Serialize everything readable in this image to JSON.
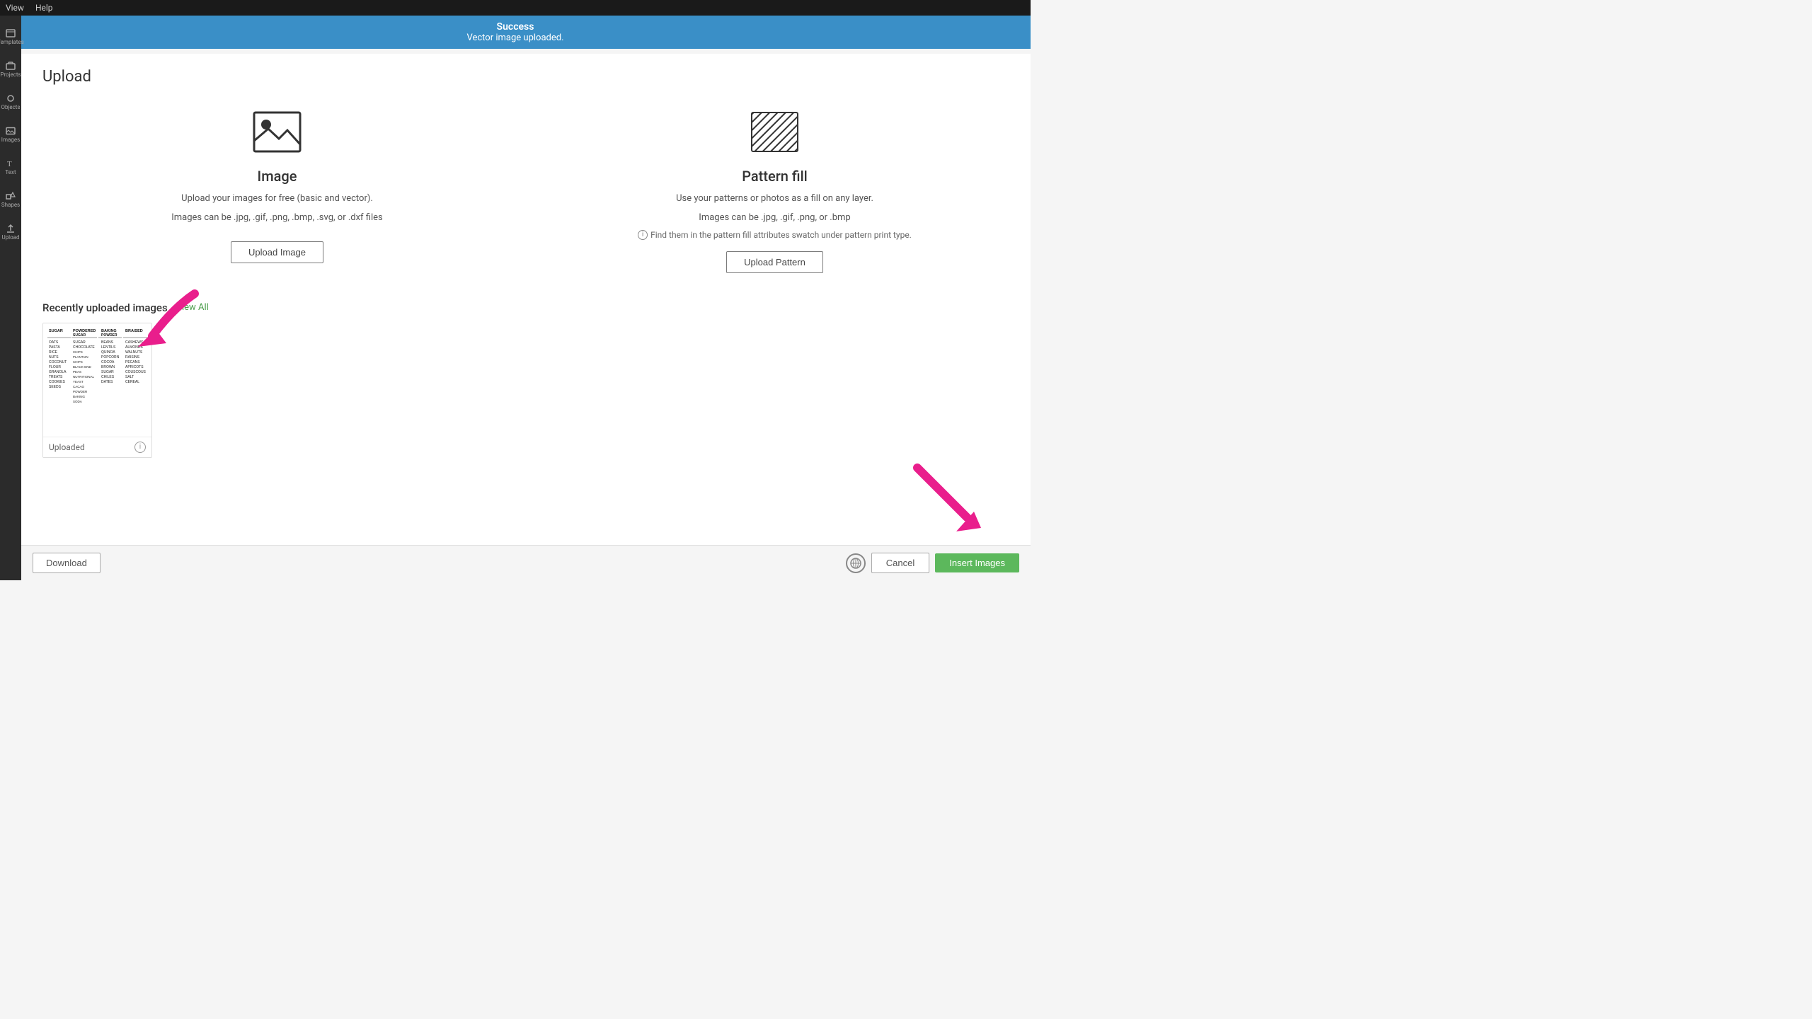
{
  "menuBar": {
    "items": [
      "View",
      "Help"
    ]
  },
  "successBanner": {
    "title": "Success",
    "subtitle": "Vector image uploaded."
  },
  "pageTitle": "Upload",
  "imageCard": {
    "title": "Image",
    "desc1": "Upload your images for free (basic and vector).",
    "desc2": "Images can be .jpg, .gif, .png, .bmp, .svg, or .dxf files",
    "buttonLabel": "Upload Image"
  },
  "patternCard": {
    "title": "Pattern fill",
    "desc1": "Use your patterns or photos as a fill on any layer.",
    "desc2": "Images can be .jpg, .gif, .png, or .bmp",
    "infoText": "Find them in the pattern fill attributes swatch under pattern print type.",
    "buttonLabel": "Upload Pattern"
  },
  "recentlyUploaded": {
    "title": "Recently uploaded images",
    "viewAllLabel": "View All",
    "thumbnails": [
      {
        "label": "Uploaded",
        "status": "uploaded"
      }
    ]
  },
  "bottomBar": {
    "downloadLabel": "Download",
    "cancelLabel": "Cancel",
    "insertLabel": "Insert Images"
  },
  "groceryColumns": [
    {
      "header": "SUGAR",
      "items": [
        "OATS",
        "PASTA",
        "RICE",
        "NUTS",
        "COCONUT",
        "FLOUR",
        "GRANOLA",
        "TREATS",
        "COOKIES",
        "SEEDS"
      ]
    },
    {
      "header": "POWDERED SUGAR",
      "items": [
        "SUGAR",
        "CHOCOLATE CHIPS",
        "PLANTAIN CHIPS",
        "BLACK-EYE PEAS",
        "NUTRITIONAL YEAST",
        "CACAO POWDER",
        "BAKING SODA"
      ]
    },
    {
      "header": "BAKING POWDER",
      "items": [
        "BEANS",
        "LENTILS",
        "QUINOA",
        "POPCORN",
        "COCOA",
        "BROWN SUGAR",
        "CHILES",
        "DATES"
      ]
    },
    {
      "header": "BRAISED",
      "items": [
        "CASHEWS",
        "ALMONDS",
        "WALNUTS",
        "RAISINS",
        "PECANS",
        "APRICOTS",
        "COUSCOUS",
        "SALT",
        "CEREAL"
      ]
    }
  ]
}
